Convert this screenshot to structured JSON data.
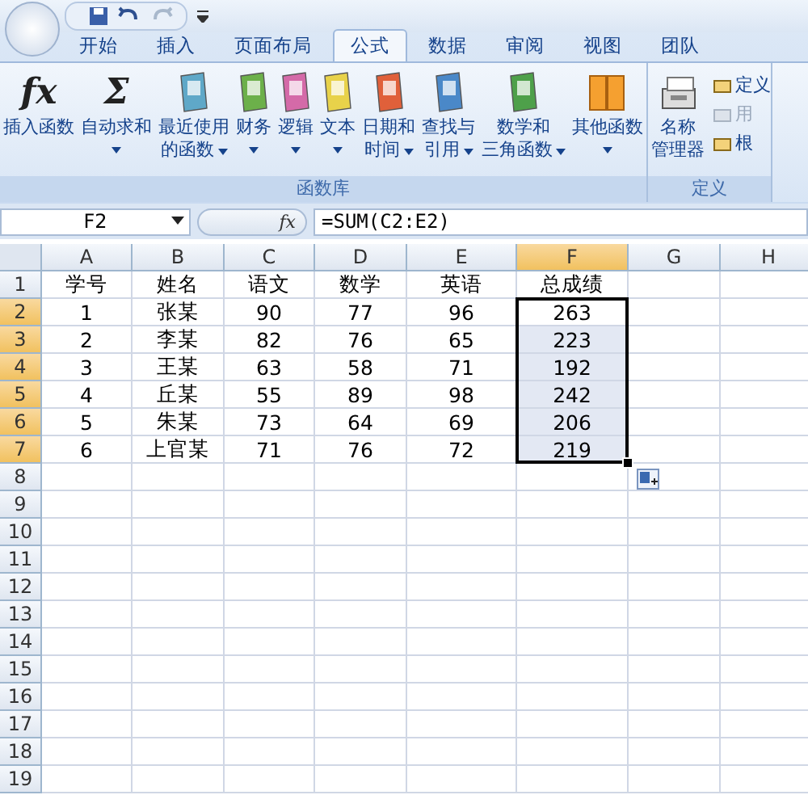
{
  "tabs": [
    {
      "label": "开始",
      "selected": false
    },
    {
      "label": "插入",
      "selected": false
    },
    {
      "label": "页面布局",
      "selected": false
    },
    {
      "label": "公式",
      "selected": true
    },
    {
      "label": "数据",
      "selected": false
    },
    {
      "label": "审阅",
      "selected": false
    },
    {
      "label": "视图",
      "selected": false
    },
    {
      "label": "团队",
      "selected": false
    }
  ],
  "ribbon_groups": [
    {
      "label": "函数库",
      "buttons": [
        {
          "kind": "glyph",
          "glyph": "fx",
          "lines": [
            "插入函数"
          ],
          "dropdown": false
        },
        {
          "kind": "glyph",
          "glyph": "Σ",
          "lines": [
            "自动求和"
          ],
          "dropdown": true
        },
        {
          "kind": "book",
          "color": "#5fa8c8",
          "lines": [
            "最近使用",
            "的函数"
          ],
          "dropdown": true
        },
        {
          "kind": "book",
          "color": "#6cb04a",
          "lines": [
            "财务"
          ],
          "dropdown": true
        },
        {
          "kind": "book",
          "color": "#d46aa8",
          "lines": [
            "逻辑"
          ],
          "dropdown": true
        },
        {
          "kind": "book",
          "color": "#e8d24a",
          "lines": [
            "文本"
          ],
          "dropdown": true
        },
        {
          "kind": "book",
          "color": "#e0603a",
          "lines": [
            "日期和",
            "时间"
          ],
          "dropdown": true
        },
        {
          "kind": "book",
          "color": "#4a88c8",
          "lines": [
            "查找与",
            "引用"
          ],
          "dropdown": true
        },
        {
          "kind": "book",
          "color": "#4ea04a",
          "lines": [
            "数学和",
            "三角函数"
          ],
          "dropdown": true
        },
        {
          "kind": "books",
          "color": "#f5a030",
          "lines": [
            "其他函数"
          ],
          "dropdown": true
        }
      ]
    },
    {
      "label": "定义",
      "buttons": [
        {
          "kind": "cabinet",
          "lines": [
            "名称",
            "管理器"
          ],
          "dropdown": false
        }
      ],
      "small_items": [
        {
          "label": "定义",
          "disabled": false
        },
        {
          "label": "用",
          "disabled": true
        },
        {
          "label": "根",
          "disabled": false
        }
      ]
    }
  ],
  "formula_bar": {
    "name_box": "F2",
    "fx": "fx",
    "formula": "=SUM(C2:E2)"
  },
  "sheet": {
    "columns": [
      {
        "label": "A",
        "selected": false
      },
      {
        "label": "B",
        "selected": false
      },
      {
        "label": "C",
        "selected": false
      },
      {
        "label": "D",
        "selected": false
      },
      {
        "label": "E",
        "selected": false
      },
      {
        "label": "F",
        "selected": true
      },
      {
        "label": "G",
        "selected": false
      },
      {
        "label": "H",
        "selected": false
      }
    ],
    "rows": [
      {
        "header": "1",
        "selected": false,
        "cells": [
          "学号",
          "姓名",
          "语文",
          "数学",
          "英语",
          "总成绩"
        ]
      },
      {
        "header": "2",
        "selected": true,
        "cells": [
          "1",
          "张某",
          "90",
          "77",
          "96",
          "263"
        ]
      },
      {
        "header": "3",
        "selected": true,
        "cells": [
          "2",
          "李某",
          "82",
          "76",
          "65",
          "223"
        ]
      },
      {
        "header": "4",
        "selected": true,
        "cells": [
          "3",
          "王某",
          "63",
          "58",
          "71",
          "192"
        ]
      },
      {
        "header": "5",
        "selected": true,
        "cells": [
          "4",
          "丘某",
          "55",
          "89",
          "98",
          "242"
        ]
      },
      {
        "header": "6",
        "selected": true,
        "cells": [
          "5",
          "朱某",
          "73",
          "64",
          "69",
          "206"
        ]
      },
      {
        "header": "7",
        "selected": true,
        "cells": [
          "6",
          "上官某",
          "71",
          "76",
          "72",
          "219"
        ]
      },
      {
        "header": "8",
        "selected": false
      },
      {
        "header": "9",
        "selected": false
      },
      {
        "header": "10",
        "selected": false
      },
      {
        "header": "11",
        "selected": false
      },
      {
        "header": "12",
        "selected": false
      },
      {
        "header": "13",
        "selected": false
      },
      {
        "header": "14",
        "selected": false
      },
      {
        "header": "15",
        "selected": false
      },
      {
        "header": "16",
        "selected": false
      },
      {
        "header": "17",
        "selected": false
      },
      {
        "header": "18",
        "selected": false
      },
      {
        "header": "19",
        "selected": false
      }
    ]
  }
}
